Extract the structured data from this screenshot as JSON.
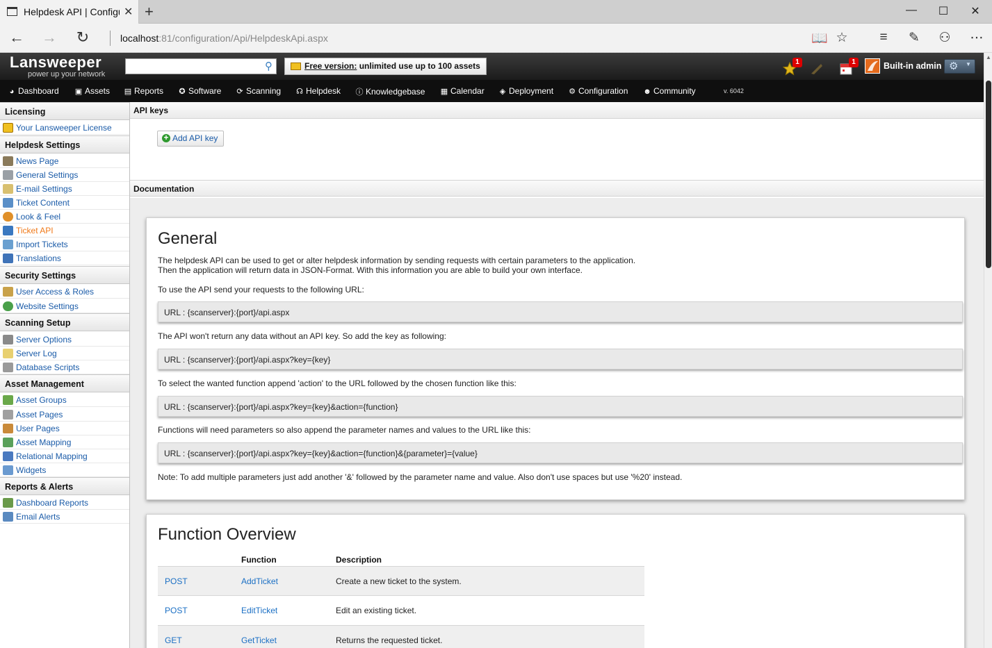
{
  "browser": {
    "tab_title": "Helpdesk API | Configur",
    "url_host": "localhost",
    "url_rest": ":81/configuration/Api/HelpdeskApi.aspx",
    "icons": [
      "page-icon",
      "close-icon",
      "plus-icon",
      "back-icon",
      "forward-icon",
      "refresh-icon",
      "reading-view-icon",
      "star-icon",
      "hub-icon",
      "note-icon",
      "share-icon",
      "more-icon",
      "minimize-icon",
      "maximize-icon",
      "window-close-icon"
    ]
  },
  "header": {
    "logo_main": "Lansweeper",
    "logo_sub": "power up your network",
    "search_value": "",
    "free_bold": "Free version:",
    "free_rest": " unlimited use up to 100 assets",
    "badge_star": "1",
    "badge_calendar": "1",
    "user_name": "Built-in admin",
    "accent": "#e46a1c"
  },
  "menu": {
    "items": [
      "Dashboard",
      "Assets",
      "Reports",
      "Software",
      "Scanning",
      "Helpdesk",
      "Knowledgebase",
      "Calendar",
      "Deployment",
      "Configuration",
      "Community"
    ],
    "version": "v. 6042"
  },
  "sidebar": {
    "sections": [
      {
        "title": "Licensing",
        "items": [
          "Your Lansweeper License"
        ]
      },
      {
        "title": "Helpdesk Settings",
        "items": [
          "News Page",
          "General Settings",
          "E-mail Settings",
          "Ticket Content",
          "Look & Feel",
          "Ticket API",
          "Import Tickets",
          "Translations"
        ]
      },
      {
        "title": "Security Settings",
        "items": [
          "User Access & Roles",
          "Website Settings"
        ]
      },
      {
        "title": "Scanning Setup",
        "items": [
          "Server Options",
          "Server Log",
          "Database Scripts"
        ]
      },
      {
        "title": "Asset Management",
        "items": [
          "Asset Groups",
          "Asset Pages",
          "User Pages",
          "Asset Mapping",
          "Relational Mapping",
          "Widgets"
        ]
      },
      {
        "title": "Reports & Alerts",
        "items": [
          "Dashboard Reports",
          "Email Alerts"
        ]
      }
    ],
    "active_item": "Ticket API",
    "active_color": "#f07a1a",
    "link_color": "#1a5ba8"
  },
  "main": {
    "api_keys_title": "API keys",
    "add_key_label": "Add API key",
    "documentation_title": "Documentation",
    "general": {
      "title": "General",
      "intro_1": "The helpdesk API can be used to get or alter helpdesk information by sending requests with certain parameters to the application.",
      "intro_2": "Then the application will return data in JSON-Format. With this information you are able to build your own interface.",
      "p1": "To use the API send your requests to the following URL:",
      "code1": "URL : {scanserver}:{port}/api.aspx",
      "p2": "The API won't return any data without an API key. So add the key as following:",
      "code2": "URL : {scanserver}:{port}/api.aspx?key={key}",
      "p3": "To select the wanted function append 'action' to the URL followed by the chosen function like this:",
      "code3": "URL : {scanserver}:{port}/api.aspx?key={key}&action={function}",
      "p4": "Functions will need parameters so also append the parameter names and values to the URL like this:",
      "code4": "URL : {scanserver}:{port}/api.aspx?key={key}&action={function}&{parameter}={value}",
      "note": "Note: To add multiple parameters just add another '&' followed by the parameter name and value. Also don't use spaces but use '%20' instead."
    },
    "functions": {
      "title": "Function Overview",
      "col_function": "Function",
      "col_description": "Description",
      "rows": [
        {
          "method": "POST",
          "function": "AddTicket",
          "description": "Create a new ticket to the system."
        },
        {
          "method": "POST",
          "function": "EditTicket",
          "description": "Edit an existing ticket."
        },
        {
          "method": "GET",
          "function": "GetTicket",
          "description": "Returns the requested ticket."
        }
      ]
    }
  }
}
